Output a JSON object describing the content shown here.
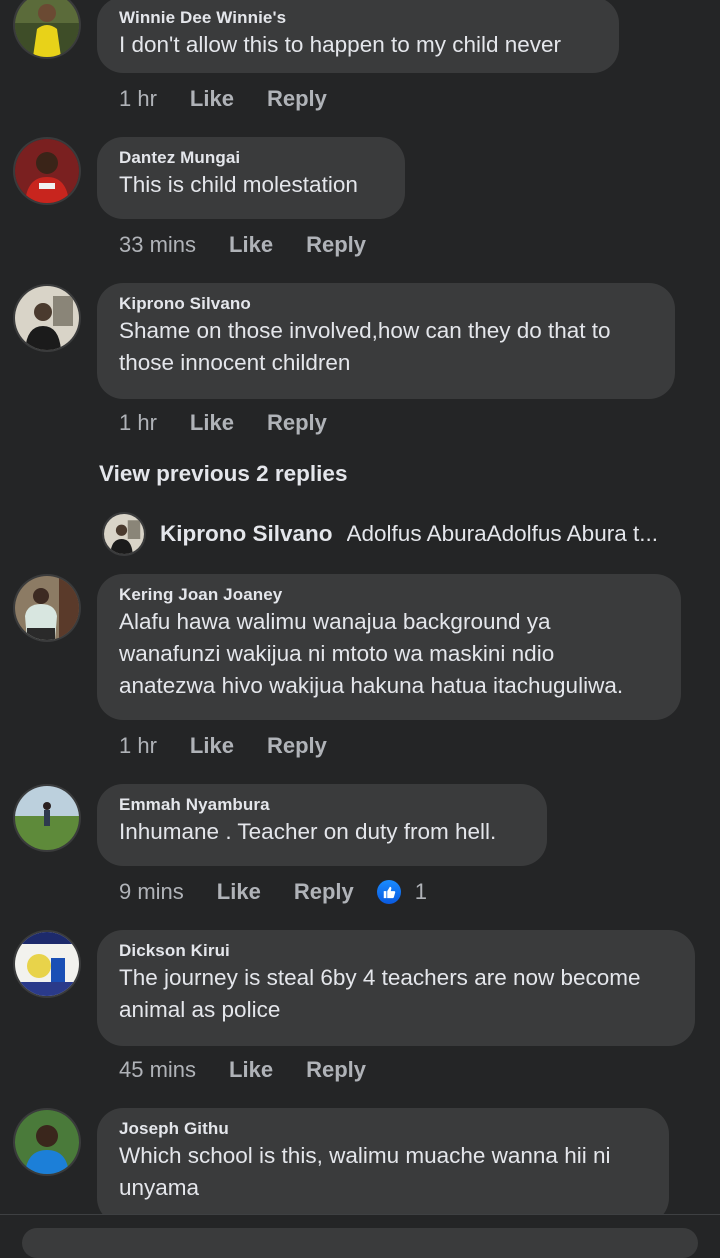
{
  "comments": [
    {
      "name": "Winnie Dee Winnie's",
      "lines": [
        "I don't allow this to happen to my child never"
      ],
      "time": "1 hr",
      "like": "Like",
      "reply": "Reply"
    },
    {
      "name": "Dantez Mungai",
      "lines": [
        "This is child molestation"
      ],
      "time": "33 mins",
      "like": "Like",
      "reply": "Reply"
    },
    {
      "name": "Kiprono Silvano",
      "lines": [
        "Shame on those involved,how can they  do that to",
        "those innocent children"
      ],
      "time": "1 hr",
      "like": "Like",
      "reply": "Reply"
    },
    {
      "name": "Kering Joan Joaney",
      "lines": [
        "Alafu hawa walimu wanajua background ya",
        "wanafunzi wakijua ni mtoto wa maskini ndio",
        "anatezwa hivo wakijua hakuna hatua itachuguliwa."
      ],
      "time": "1 hr",
      "like": "Like",
      "reply": "Reply"
    },
    {
      "name": "Emmah Nyambura",
      "lines": [
        "Inhumane . Teacher on duty from hell."
      ],
      "time": "9 mins",
      "like": "Like",
      "reply": "Reply",
      "reaction_count": "1"
    },
    {
      "name": "Dickson Kirui",
      "lines": [
        "The journey is steal 6by 4 teachers are now become",
        "animal as police"
      ],
      "time": "45 mins",
      "like": "Like",
      "reply": "Reply"
    },
    {
      "name": "Joseph Githu",
      "lines": [
        "Which school is this, walimu muache wanna hii ni",
        "unyama"
      ]
    }
  ],
  "thread": {
    "view_previous": "View previous 2 replies",
    "preview_name": "Kiprono Silvano",
    "preview_text": "Adolfus AburaAdolfus Abura t..."
  },
  "icons": {
    "reaction": "thumbs-up-icon"
  },
  "colors": {
    "background": "#242526",
    "bubble": "#3a3b3c",
    "meta_text": "#b0b3b8",
    "like_badge": "#1877f2"
  }
}
